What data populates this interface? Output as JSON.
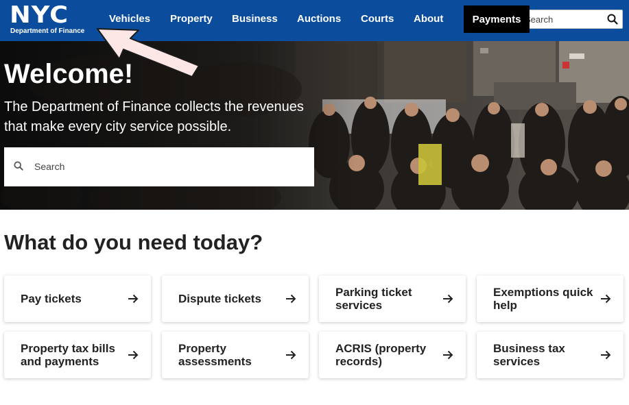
{
  "header": {
    "logo_text": "NYC",
    "logo_subtext": "Department of Finance",
    "nav": [
      "Vehicles",
      "Property",
      "Business",
      "Auctions",
      "Courts",
      "About"
    ],
    "payments_label": "Payments",
    "search_placeholder": "Search",
    "brand_color": "#0b4d9c"
  },
  "hero": {
    "title": "Welcome!",
    "subtitle": "The Department of Finance collects the revenues that make every city service possible.",
    "search_placeholder": "Search"
  },
  "services": {
    "title": "What do you need today?",
    "cards": [
      {
        "label": "Pay tickets"
      },
      {
        "label": "Dispute tickets"
      },
      {
        "label": "Parking ticket services"
      },
      {
        "label": "Exemptions quick help"
      },
      {
        "label": "Property tax bills and payments"
      },
      {
        "label": "Property assessments"
      },
      {
        "label": "ACRIS (property records)"
      },
      {
        "label": "Business tax services"
      }
    ]
  },
  "icons": {
    "search": "search-icon",
    "card_arrow": "arrow-right-icon",
    "annotation": "annotation-arrow"
  }
}
